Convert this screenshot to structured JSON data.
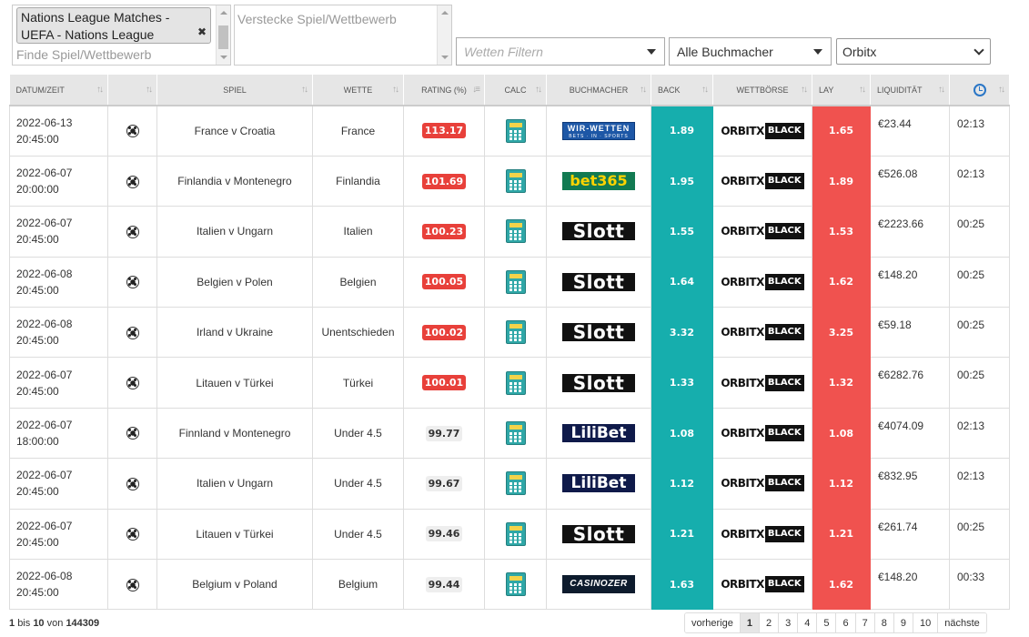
{
  "filters": {
    "selected_competition": "Nations League Matches - UEFA - Nations League",
    "find_placeholder": "Finde Spiel/Wettbewerb",
    "hide_placeholder": "Verstecke Spiel/Wettbewerb",
    "bets_filter_placeholder": "Wetten Filtern",
    "bookmaker_select": "Alle Buchmacher",
    "exchange_select": "Orbitx"
  },
  "table": {
    "headers": {
      "datetime": "DATUM/ZEIT",
      "game": "SPIEL",
      "bet": "WETTE",
      "rating": "RATING (%)",
      "calc": "CALC",
      "bookmaker": "BUCHMACHER",
      "back": "BACK",
      "exchange": "WETTBÖRSE",
      "lay": "LAY",
      "liquidity": "LIQUIDITÄT"
    },
    "rows": [
      {
        "date": "2022-06-13",
        "time": "20:45:00",
        "game": "France v Croatia",
        "bet": "France",
        "rating": "113.17",
        "bookmaker": "WIR-WETTEN",
        "bookmaker_sub": "BETS · IN · SPORTS",
        "back": "1.89",
        "exchange_a": "ORBITX",
        "exchange_b": "BLACK",
        "lay": "1.65",
        "liquidity": "€23.44",
        "updated": "02:13"
      },
      {
        "date": "2022-06-07",
        "time": "20:00:00",
        "game": "Finlandia v Montenegro",
        "bet": "Finlandia",
        "rating": "101.69",
        "bookmaker": "bet365",
        "bookmaker_sub": "",
        "back": "1.95",
        "exchange_a": "ORBITX",
        "exchange_b": "BLACK",
        "lay": "1.89",
        "liquidity": "€526.08",
        "updated": "02:13"
      },
      {
        "date": "2022-06-07",
        "time": "20:45:00",
        "game": "Italien v Ungarn",
        "bet": "Italien",
        "rating": "100.23",
        "bookmaker": "Slott",
        "bookmaker_sub": "",
        "back": "1.55",
        "exchange_a": "ORBITX",
        "exchange_b": "BLACK",
        "lay": "1.53",
        "liquidity": "€2223.66",
        "updated": "00:25"
      },
      {
        "date": "2022-06-08",
        "time": "20:45:00",
        "game": "Belgien v Polen",
        "bet": "Belgien",
        "rating": "100.05",
        "bookmaker": "Slott",
        "bookmaker_sub": "",
        "back": "1.64",
        "exchange_a": "ORBITX",
        "exchange_b": "BLACK",
        "lay": "1.62",
        "liquidity": "€148.20",
        "updated": "00:25"
      },
      {
        "date": "2022-06-08",
        "time": "20:45:00",
        "game": "Irland v Ukraine",
        "bet": "Unentschieden",
        "rating": "100.02",
        "bookmaker": "Slott",
        "bookmaker_sub": "",
        "back": "3.32",
        "exchange_a": "ORBITX",
        "exchange_b": "BLACK",
        "lay": "3.25",
        "liquidity": "€59.18",
        "updated": "00:25"
      },
      {
        "date": "2022-06-07",
        "time": "20:45:00",
        "game": "Litauen v Türkei",
        "bet": "Türkei",
        "rating": "100.01",
        "bookmaker": "Slott",
        "bookmaker_sub": "",
        "back": "1.33",
        "exchange_a": "ORBITX",
        "exchange_b": "BLACK",
        "lay": "1.32",
        "liquidity": "€6282.76",
        "updated": "00:25"
      },
      {
        "date": "2022-06-07",
        "time": "18:00:00",
        "game": "Finnland v Montenegro",
        "bet": "Under 4.5",
        "rating": "99.77",
        "bookmaker": "LiliBet",
        "bookmaker_sub": "",
        "back": "1.08",
        "exchange_a": "ORBITX",
        "exchange_b": "BLACK",
        "lay": "1.08",
        "liquidity": "€4074.09",
        "updated": "02:13"
      },
      {
        "date": "2022-06-07",
        "time": "20:45:00",
        "game": "Italien v Ungarn",
        "bet": "Under 4.5",
        "rating": "99.67",
        "bookmaker": "LiliBet",
        "bookmaker_sub": "",
        "back": "1.12",
        "exchange_a": "ORBITX",
        "exchange_b": "BLACK",
        "lay": "1.12",
        "liquidity": "€832.95",
        "updated": "02:13"
      },
      {
        "date": "2022-06-07",
        "time": "20:45:00",
        "game": "Litauen v Türkei",
        "bet": "Under 4.5",
        "rating": "99.46",
        "bookmaker": "Slott",
        "bookmaker_sub": "",
        "back": "1.21",
        "exchange_a": "ORBITX",
        "exchange_b": "BLACK",
        "lay": "1.21",
        "liquidity": "€261.74",
        "updated": "00:25"
      },
      {
        "date": "2022-06-08",
        "time": "20:45:00",
        "game": "Belgium v Poland",
        "bet": "Belgium",
        "rating": "99.44",
        "bookmaker": "CASINOZER",
        "bookmaker_sub": "",
        "back": "1.63",
        "exchange_a": "ORBITX",
        "exchange_b": "BLACK",
        "lay": "1.62",
        "liquidity": "€148.20",
        "updated": "00:33"
      }
    ]
  },
  "footer": {
    "from": "1",
    "to": "10",
    "total": "144309",
    "bis": "bis",
    "von": "von",
    "prev": "vorherige",
    "next": "nächste",
    "pages": [
      "1",
      "2",
      "3",
      "4",
      "5",
      "6",
      "7",
      "8",
      "9",
      "10"
    ],
    "active_page": "1"
  },
  "colors": {
    "back": "#16aead",
    "lay": "#f0524f",
    "rating_hot": "#e8403a"
  }
}
